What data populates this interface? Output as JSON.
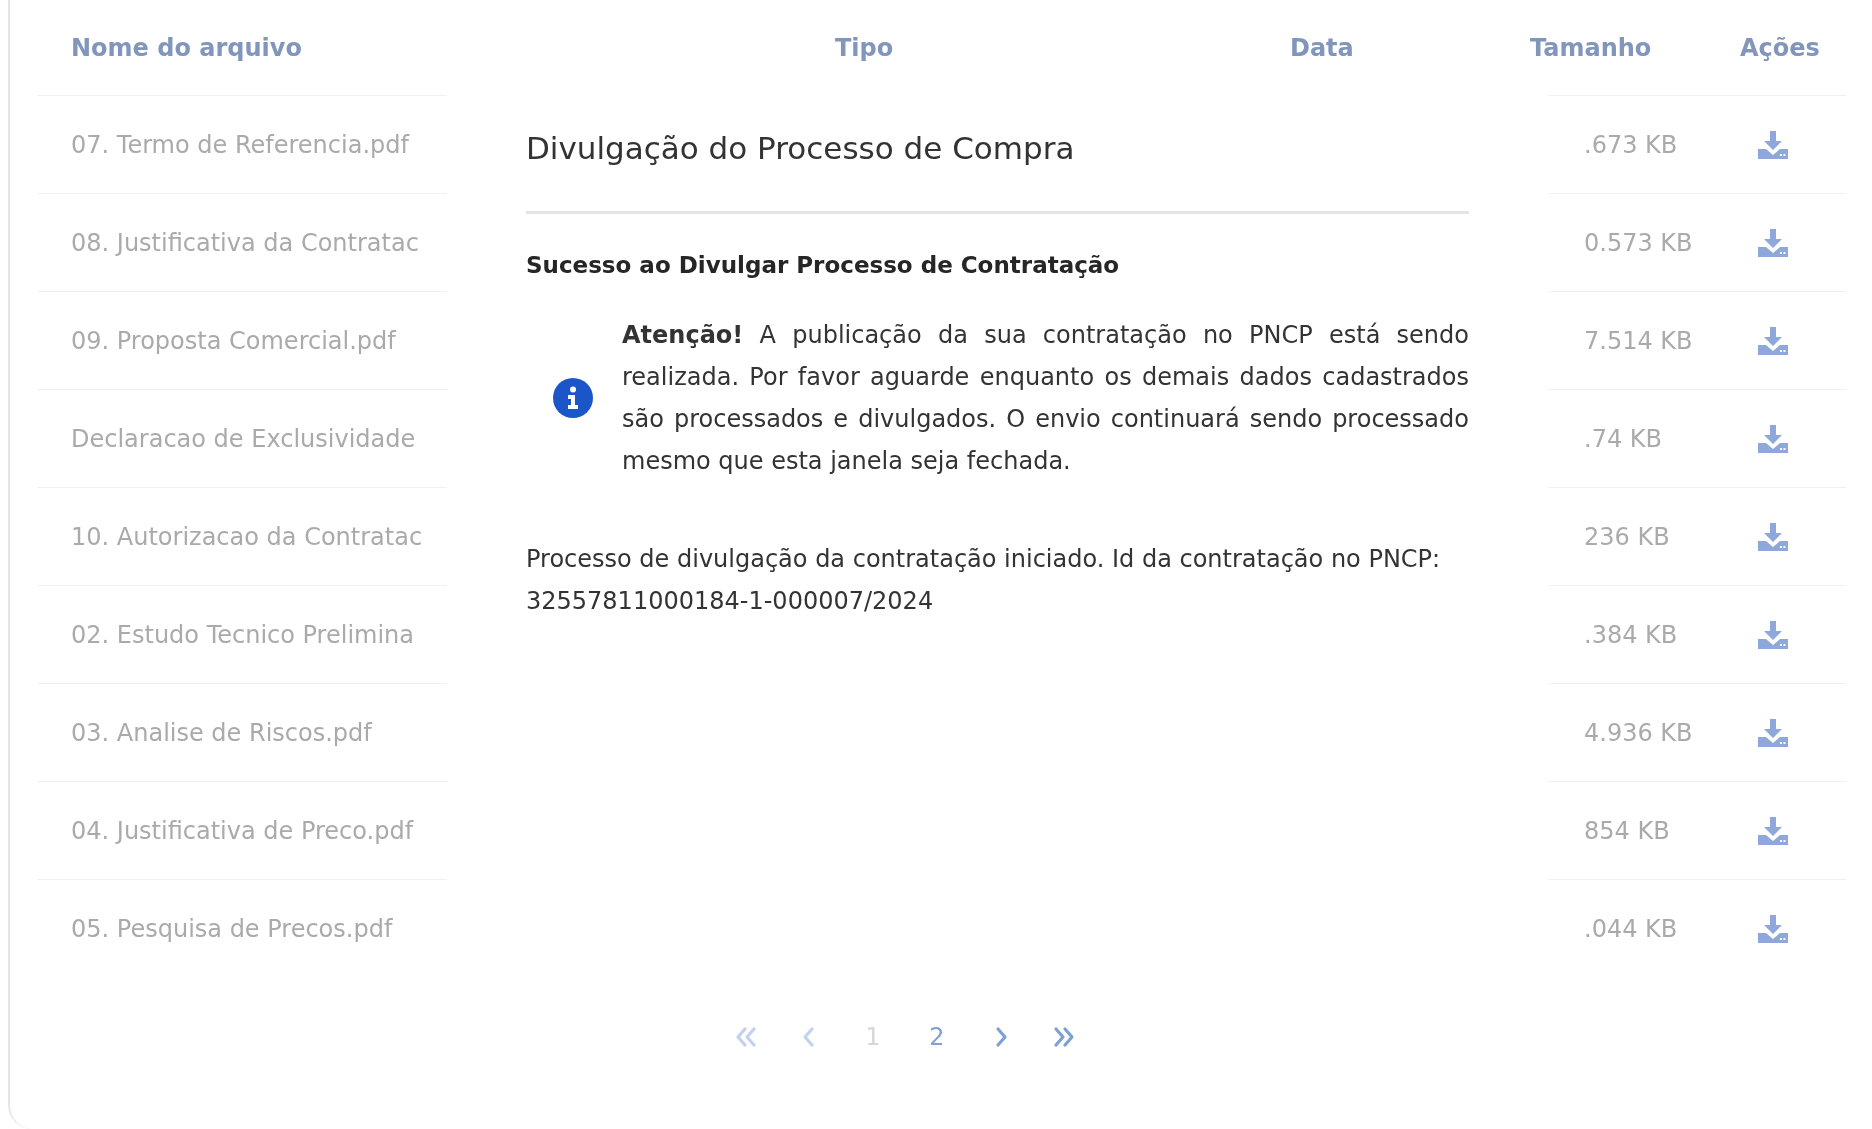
{
  "table": {
    "columns": [
      "Nome do arquivo",
      "Tipo",
      "Data",
      "Tamanho",
      "Ações"
    ],
    "rows": [
      {
        "name": "07. Termo de Referencia.pdf",
        "size": ".673 KB"
      },
      {
        "name": "08. Justificativa da Contratac",
        "size": "0.573 KB"
      },
      {
        "name": "09. Proposta Comercial.pdf",
        "size": "7.514 KB"
      },
      {
        "name": "Declaracao de Exclusividade",
        "size": ".74 KB"
      },
      {
        "name": "10. Autorizacao da Contratac",
        "size": "236 KB"
      },
      {
        "name": "02. Estudo Tecnico Prelimina",
        "size": ".384 KB"
      },
      {
        "name": "03. Analise de Riscos.pdf",
        "size": "4.936 KB"
      },
      {
        "name": "04. Justificativa de Preco.pdf",
        "size": "854 KB"
      },
      {
        "name": "05. Pesquisa de Precos.pdf",
        "size": ".044 KB"
      }
    ]
  },
  "dialog": {
    "title": "Divulgação do Processo de Compra",
    "heading": "Sucesso ao Divulgar Processo de Contratação",
    "alert": "**Atenção!** A publicação da sua contratação no PNCP está sendo realizada. Por favor aguarde enquanto os demais dados cadastrados são processados e divulgados. O envio continuará sendo processado mesmo que esta janela seja fechada.",
    "message": "Processo de divulgação da contratação iniciado. Id da contratação no PNCP: 32557811000184-1-000007/2024"
  },
  "pagination": [
    {
      "kind": "first",
      "disabled": true
    },
    {
      "kind": "prev",
      "disabled": true
    },
    {
      "kind": "page",
      "label": "1",
      "selected": true
    },
    {
      "kind": "page",
      "label": "2",
      "selected": false
    },
    {
      "kind": "next",
      "disabled": false
    },
    {
      "kind": "last",
      "disabled": false
    }
  ]
}
